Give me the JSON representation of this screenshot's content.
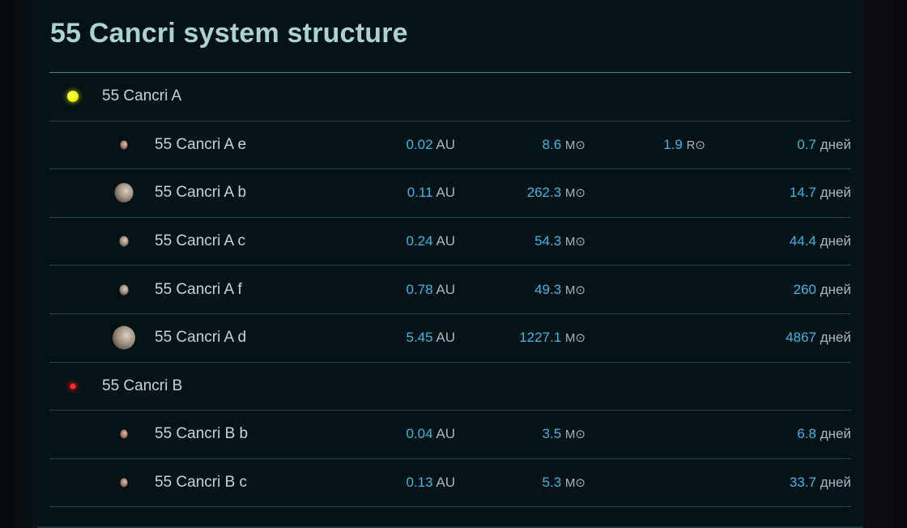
{
  "title": "55 Cancri system structure",
  "units": {
    "au": "AU",
    "mass": "M⊙",
    "radius": "R⊙",
    "period": "дней"
  },
  "stars": [
    {
      "name": "55 Cancri A",
      "color": "#f2f400",
      "planets": [
        {
          "name": "55 Cancri A e",
          "au": "0.02",
          "mass": "8.6",
          "radius": "1.9",
          "period": "0.7"
        },
        {
          "name": "55 Cancri A b",
          "au": "0.11",
          "mass": "262.3",
          "radius": "",
          "period": "14.7"
        },
        {
          "name": "55 Cancri A c",
          "au": "0.24",
          "mass": "54.3",
          "radius": "",
          "period": "44.4"
        },
        {
          "name": "55 Cancri A f",
          "au": "0.78",
          "mass": "49.3",
          "radius": "",
          "period": "260"
        },
        {
          "name": "55 Cancri A d",
          "au": "5.45",
          "mass": "1227.1",
          "radius": "",
          "period": "4867"
        }
      ]
    },
    {
      "name": "55 Cancri B",
      "color": "#ff2a2a",
      "planets": [
        {
          "name": "55 Cancri B b",
          "au": "0.04",
          "mass": "3.5",
          "radius": "",
          "period": "6.8"
        },
        {
          "name": "55 Cancri B c",
          "au": "0.13",
          "mass": "5.3",
          "radius": "",
          "period": "33.7"
        }
      ]
    }
  ]
}
